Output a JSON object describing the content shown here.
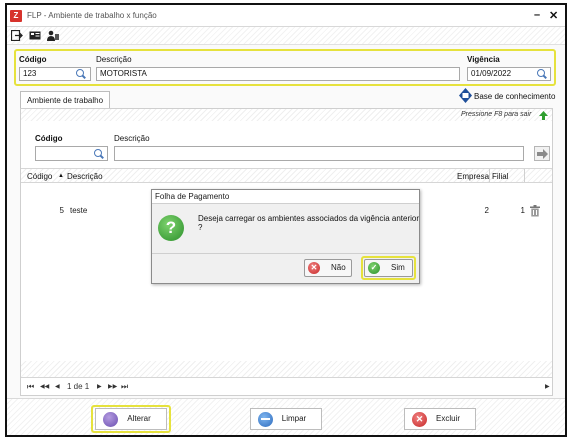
{
  "window": {
    "title": "FLP - Ambiente de trabalho x função",
    "app_icon_glyph": "Z",
    "minimize_glyph": "–",
    "close_glyph": "✕"
  },
  "toolbar": {
    "icons": [
      "exit-icon",
      "card-icon",
      "users-icon"
    ]
  },
  "header": {
    "codigo_label": "Código",
    "codigo_value": "123",
    "descricao_label": "Descrição",
    "descricao_value": "MOTORISTA",
    "vigencia_label": "Vigência",
    "vigencia_value": "01/09/2022"
  },
  "tabs": [
    {
      "label": "Ambiente de trabalho"
    }
  ],
  "knowledge_base": {
    "label": "Base de conhecimento",
    "hint": "Pressione F8 para sair"
  },
  "filter": {
    "codigo_label": "Código",
    "descricao_label": "Descrição"
  },
  "grid": {
    "columns": {
      "codigo": "Código",
      "descricao": "Descrição",
      "empresa": "Empresa",
      "filial": "Filial"
    },
    "rows": [
      {
        "codigo": "5",
        "descricao": "teste",
        "empresa": "2",
        "filial": "1"
      }
    ]
  },
  "pager": {
    "first": "⏮",
    "prev_fast": "◀◀",
    "prev": "◀",
    "page_text": "1 de 1",
    "next": "▶",
    "next_fast": "▶▶",
    "last": "⏭"
  },
  "dialog": {
    "title": "Folha de Pagamento",
    "message": "Deseja carregar os ambientes associados da vigência anterior ?",
    "no_label": "Não",
    "yes_label": "Sim",
    "icon_glyph": "?"
  },
  "footer": {
    "alterar_label": "Alterar",
    "limpar_label": "Limpar",
    "excluir_label": "Excluir"
  },
  "colors": {
    "highlight": "#e6e23d",
    "accent_blue": "#4a78b8",
    "green": "#2a8f2a",
    "red": "#d7332c"
  }
}
